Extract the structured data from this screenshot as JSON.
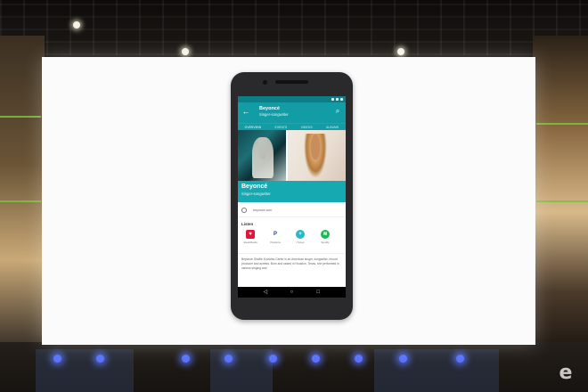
{
  "app": {
    "title": "Beyoncé",
    "subtitle": "Singer-songwriter"
  },
  "tabs": [
    {
      "label": "OVERVIEW",
      "active": true
    },
    {
      "label": "EVENTS",
      "active": false
    },
    {
      "label": "VIDEOS",
      "active": false
    },
    {
      "label": "ALBUMS",
      "active": false
    }
  ],
  "artist": {
    "name": "Beyoncé",
    "role": "Singer-songwriter"
  },
  "website": "beyonce.com",
  "listen": {
    "title": "Listen",
    "services": [
      {
        "label": "iHeartRadio",
        "icon": "iheartradio-icon",
        "color": "#e0173a",
        "glyph": "♥"
      },
      {
        "label": "Pandora",
        "icon": "pandora-icon",
        "color": "#ffffff",
        "glyph": "P"
      },
      {
        "label": "iTunes",
        "icon": "itunes-icon",
        "color": "#2bb7c4",
        "glyph": "+"
      },
      {
        "label": "Spotify",
        "icon": "spotify-icon",
        "color": "#1db954",
        "glyph": "≋"
      }
    ]
  },
  "bio": "Beyoncé Giselle Knowles-Carter is an American singer, songwriter, record producer and actress. Born and raised in Houston, Texas, she performed in various singing and",
  "nav": [
    "◁",
    "○",
    "□"
  ],
  "colors": {
    "accent": "#129ca6",
    "banner": "#17a9b2"
  }
}
